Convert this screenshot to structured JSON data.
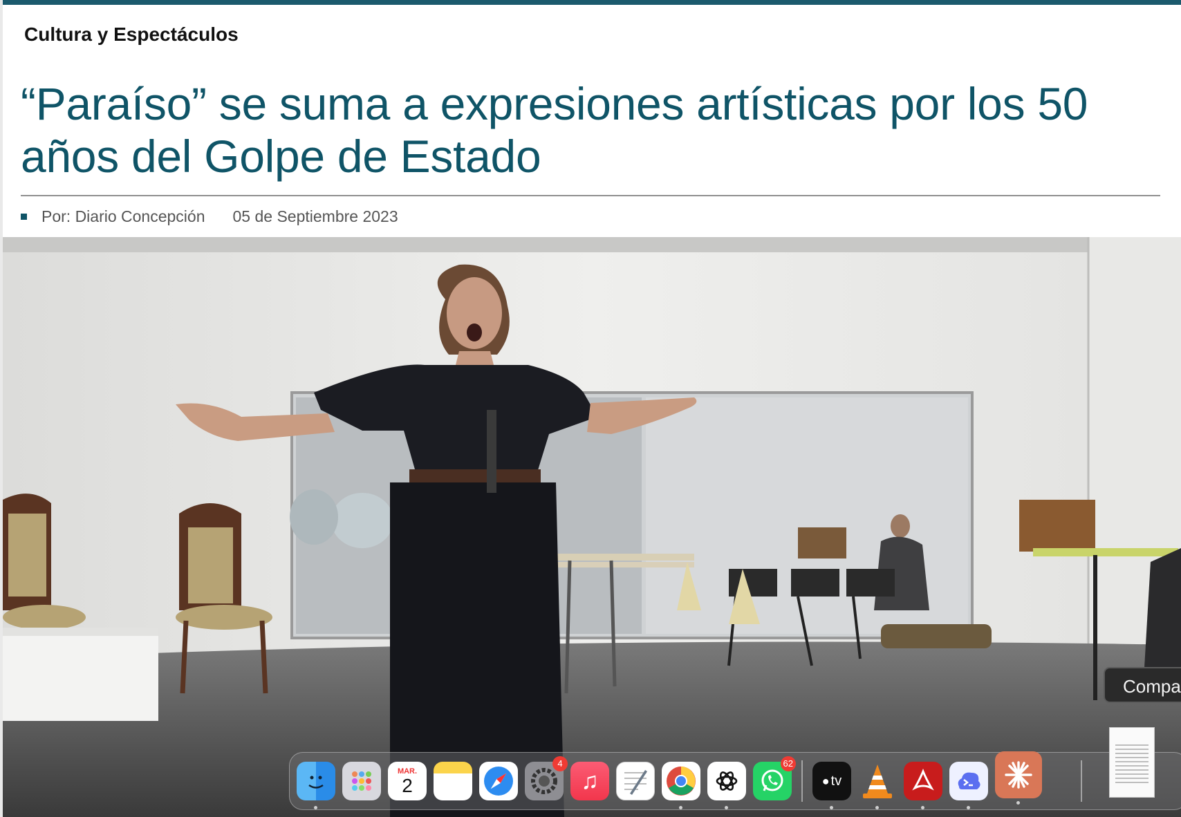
{
  "article": {
    "section": "Cultura y Espectáculos",
    "headline": "“Paraíso” se suma a expresiones artísticas por los 50 años del Golpe de Estado",
    "author": "Por: Diario Concepción",
    "date": "05 de Septiembre 2023"
  },
  "tooltip": {
    "text": "Compa"
  },
  "dock": {
    "calendar": {
      "month": "MAR.",
      "day": "2"
    },
    "system_settings_badge": "4",
    "whatsapp_badge": "62",
    "tv_label": "tv",
    "apps": [
      "finder-icon",
      "launchpad-icon",
      "calendar-icon",
      "notes-icon",
      "safari-icon",
      "system-settings-icon",
      "music-icon",
      "textedit-icon",
      "chrome-icon",
      "chatgpt-icon",
      "whatsapp-icon",
      "apple-tv-icon",
      "vlc-icon",
      "acrobat-icon",
      "terminal-app-icon",
      "claude-icon"
    ]
  },
  "colors": {
    "accent": "#0f5467",
    "top_bar": "#1b5a6d",
    "badge": "#ef3b34"
  }
}
